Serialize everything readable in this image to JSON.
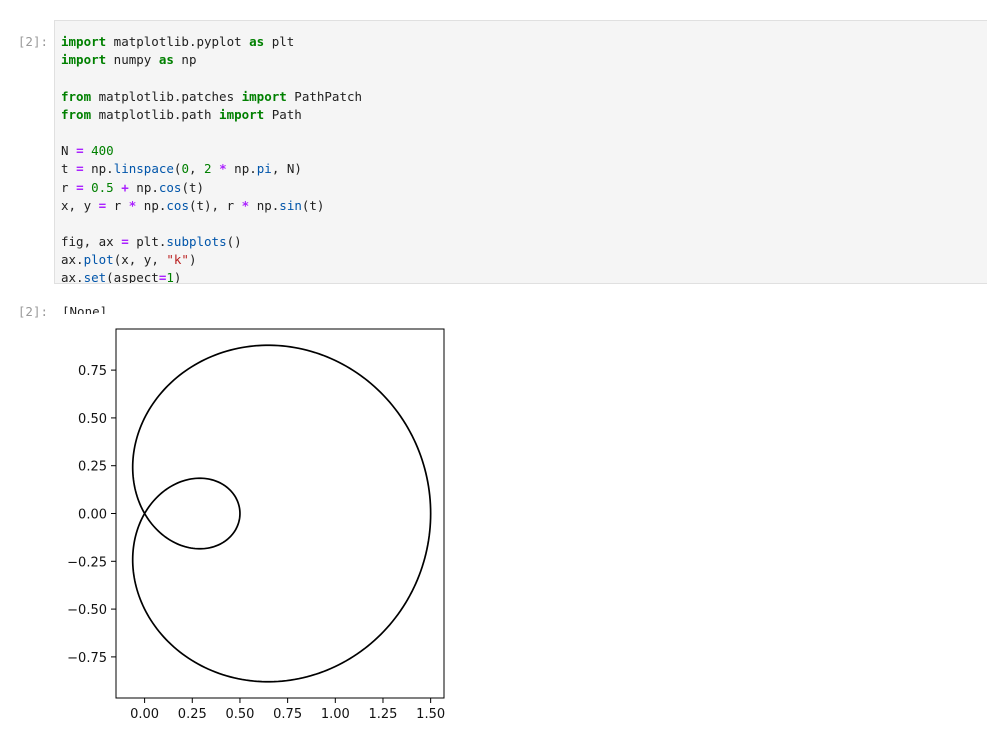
{
  "cell": {
    "input_prompt": "[2]:",
    "output_prompt": "[2]:",
    "output_text": "[None]",
    "code_lines": [
      [
        {
          "t": "import",
          "c": "kw"
        },
        {
          "t": " matplotlib.pyplot "
        },
        {
          "t": "as",
          "c": "kw"
        },
        {
          "t": " plt"
        }
      ],
      [
        {
          "t": "import",
          "c": "kw"
        },
        {
          "t": " numpy "
        },
        {
          "t": "as",
          "c": "kw"
        },
        {
          "t": " np"
        }
      ],
      [],
      [
        {
          "t": "from",
          "c": "kw"
        },
        {
          "t": " matplotlib.patches "
        },
        {
          "t": "import",
          "c": "kw"
        },
        {
          "t": " PathPatch"
        }
      ],
      [
        {
          "t": "from",
          "c": "kw"
        },
        {
          "t": " matplotlib.path "
        },
        {
          "t": "import",
          "c": "kw"
        },
        {
          "t": " Path"
        }
      ],
      [],
      [
        {
          "t": "N "
        },
        {
          "t": "=",
          "c": "op"
        },
        {
          "t": " "
        },
        {
          "t": "400",
          "c": "num"
        }
      ],
      [
        {
          "t": "t "
        },
        {
          "t": "=",
          "c": "op"
        },
        {
          "t": " np."
        },
        {
          "t": "linspace",
          "c": "attr"
        },
        {
          "t": "("
        },
        {
          "t": "0",
          "c": "num"
        },
        {
          "t": ", "
        },
        {
          "t": "2",
          "c": "num"
        },
        {
          "t": " "
        },
        {
          "t": "*",
          "c": "op"
        },
        {
          "t": " np."
        },
        {
          "t": "pi",
          "c": "attr"
        },
        {
          "t": ", N)"
        }
      ],
      [
        {
          "t": "r "
        },
        {
          "t": "=",
          "c": "op"
        },
        {
          "t": " "
        },
        {
          "t": "0.5",
          "c": "num"
        },
        {
          "t": " "
        },
        {
          "t": "+",
          "c": "op"
        },
        {
          "t": " np."
        },
        {
          "t": "cos",
          "c": "attr"
        },
        {
          "t": "(t)"
        }
      ],
      [
        {
          "t": "x, y "
        },
        {
          "t": "=",
          "c": "op"
        },
        {
          "t": " r "
        },
        {
          "t": "*",
          "c": "op"
        },
        {
          "t": " np."
        },
        {
          "t": "cos",
          "c": "attr"
        },
        {
          "t": "(t), r "
        },
        {
          "t": "*",
          "c": "op"
        },
        {
          "t": " np."
        },
        {
          "t": "sin",
          "c": "attr"
        },
        {
          "t": "(t)"
        }
      ],
      [],
      [
        {
          "t": "fig, ax "
        },
        {
          "t": "=",
          "c": "op"
        },
        {
          "t": " plt."
        },
        {
          "t": "subplots",
          "c": "attr"
        },
        {
          "t": "()"
        }
      ],
      [
        {
          "t": "ax."
        },
        {
          "t": "plot",
          "c": "attr"
        },
        {
          "t": "(x, y, "
        },
        {
          "t": "\"k\"",
          "c": "str"
        },
        {
          "t": ")"
        }
      ],
      [
        {
          "t": "ax."
        },
        {
          "t": "set",
          "c": "attr"
        },
        {
          "t": "(aspect"
        },
        {
          "t": "=",
          "c": "op"
        },
        {
          "t": "1",
          "c": "num"
        },
        {
          "t": ")"
        }
      ]
    ]
  },
  "chart_data": {
    "type": "line",
    "series": [
      {
        "equation": "x = (0.5 + cos t)·cos t, y = (0.5 + cos t)·sin t, t ∈ [0, 2π], N = 400",
        "color": "#000000",
        "samples": 400
      }
    ],
    "xlim": [
      -0.15,
      1.57
    ],
    "ylim": [
      -0.965,
      0.965
    ],
    "xticks": [
      "0.00",
      "0.25",
      "0.50",
      "0.75",
      "1.00",
      "1.25",
      "1.50"
    ],
    "yticks": [
      "0.75",
      "0.50",
      "0.25",
      "0.00",
      "−0.25",
      "−0.50",
      "−0.75"
    ],
    "grid": false,
    "aspect": 1
  }
}
